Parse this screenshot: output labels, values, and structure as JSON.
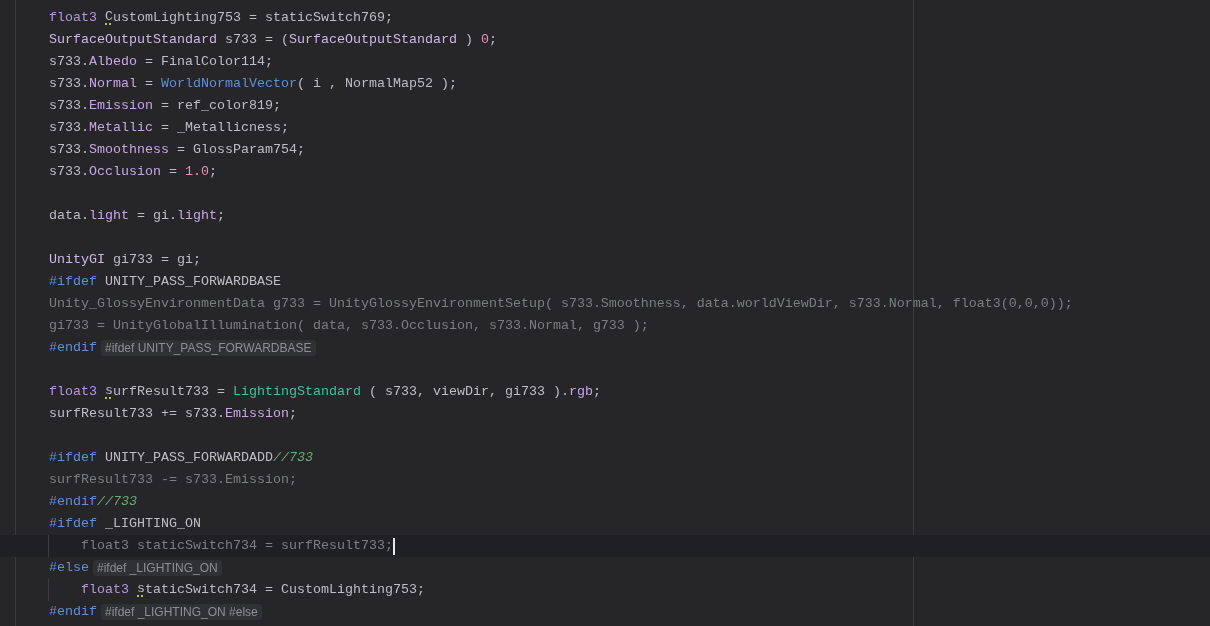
{
  "editor": {
    "lines": [
      {
        "kind": "code",
        "tokens": [
          {
            "kind": "keyword",
            "text": "float3 "
          },
          {
            "kind": "plain",
            "text": "C",
            "squiggle": true
          },
          {
            "kind": "plain",
            "text": "ustomLighting753 = staticSwitch769;"
          }
        ]
      },
      {
        "kind": "code",
        "tokens": [
          {
            "kind": "type",
            "text": "SurfaceOutputStandard"
          },
          {
            "kind": "plain",
            "text": " s733 = ("
          },
          {
            "kind": "type",
            "text": "SurfaceOutputStandard"
          },
          {
            "kind": "plain",
            "text": " ) "
          },
          {
            "kind": "number",
            "text": "0"
          },
          {
            "kind": "plain",
            "text": ";"
          }
        ]
      },
      {
        "kind": "code",
        "tokens": [
          {
            "kind": "plain",
            "text": "s733."
          },
          {
            "kind": "field",
            "text": "Albedo"
          },
          {
            "kind": "plain",
            "text": " = FinalColor114;"
          }
        ]
      },
      {
        "kind": "code",
        "tokens": [
          {
            "kind": "plain",
            "text": "s733."
          },
          {
            "kind": "field",
            "text": "Normal"
          },
          {
            "kind": "plain",
            "text": " = "
          },
          {
            "kind": "function",
            "text": "WorldNormalVector"
          },
          {
            "kind": "plain",
            "text": "( i , NormalMap52 );"
          }
        ]
      },
      {
        "kind": "code",
        "tokens": [
          {
            "kind": "plain",
            "text": "s733."
          },
          {
            "kind": "field",
            "text": "Emission"
          },
          {
            "kind": "plain",
            "text": " = ref_color819;"
          }
        ]
      },
      {
        "kind": "code",
        "tokens": [
          {
            "kind": "plain",
            "text": "s733."
          },
          {
            "kind": "field",
            "text": "Metallic"
          },
          {
            "kind": "plain",
            "text": " = _Metallicness;"
          }
        ]
      },
      {
        "kind": "code",
        "tokens": [
          {
            "kind": "plain",
            "text": "s733."
          },
          {
            "kind": "field",
            "text": "Smoothness"
          },
          {
            "kind": "plain",
            "text": " = GlossParam754;"
          }
        ]
      },
      {
        "kind": "code",
        "tokens": [
          {
            "kind": "plain",
            "text": "s733."
          },
          {
            "kind": "field",
            "text": "Occlusion"
          },
          {
            "kind": "plain",
            "text": " = "
          },
          {
            "kind": "number",
            "text": "1.0"
          },
          {
            "kind": "plain",
            "text": ";"
          }
        ]
      },
      {
        "kind": "blank"
      },
      {
        "kind": "code",
        "tokens": [
          {
            "kind": "plain",
            "text": "data."
          },
          {
            "kind": "field",
            "text": "light"
          },
          {
            "kind": "plain",
            "text": " = gi."
          },
          {
            "kind": "field",
            "text": "light"
          },
          {
            "kind": "plain",
            "text": ";"
          }
        ]
      },
      {
        "kind": "blank"
      },
      {
        "kind": "code",
        "tokens": [
          {
            "kind": "type",
            "text": "UnityGI"
          },
          {
            "kind": "plain",
            "text": " gi733 = gi;"
          }
        ]
      },
      {
        "kind": "code",
        "tokens": [
          {
            "kind": "directive",
            "text": "#ifdef"
          },
          {
            "kind": "plain",
            "text": " UNITY_PASS_FORWARDBASE"
          }
        ]
      },
      {
        "kind": "code",
        "tokens": [
          {
            "kind": "inactive",
            "text": "Unity_GlossyEnvironmentData g733 = UnityGlossyEnvironmentSetup( s733.Smoothness, data.worldViewDir, s733.Normal, float3(0,0,0));"
          }
        ]
      },
      {
        "kind": "code",
        "tokens": [
          {
            "kind": "inactive",
            "text": "gi733 = UnityGlobalIllumination( data, s733.Occlusion, s733.Normal, g733 );"
          }
        ]
      },
      {
        "kind": "code",
        "tokens": [
          {
            "kind": "directive",
            "text": "#endif"
          },
          {
            "kind": "hint",
            "text": "#ifdef UNITY_PASS_FORWARDBASE"
          }
        ]
      },
      {
        "kind": "blank"
      },
      {
        "kind": "code",
        "tokens": [
          {
            "kind": "keyword",
            "text": "float3 "
          },
          {
            "kind": "plain",
            "text": "s",
            "squiggle": true
          },
          {
            "kind": "plain",
            "text": "urfResult733 = "
          },
          {
            "kind": "call",
            "text": "LightingStandard"
          },
          {
            "kind": "plain",
            "text": " ( s733, viewDir, gi733 )."
          },
          {
            "kind": "field",
            "text": "rgb"
          },
          {
            "kind": "plain",
            "text": ";"
          }
        ]
      },
      {
        "kind": "code",
        "tokens": [
          {
            "kind": "plain",
            "text": "surfResult733 += s733."
          },
          {
            "kind": "field",
            "text": "Emission"
          },
          {
            "kind": "plain",
            "text": ";"
          }
        ]
      },
      {
        "kind": "blank"
      },
      {
        "kind": "code",
        "tokens": [
          {
            "kind": "directive",
            "text": "#ifdef"
          },
          {
            "kind": "plain",
            "text": " UNITY_PASS_FORWARDADD"
          },
          {
            "kind": "comment",
            "text": "//733"
          }
        ]
      },
      {
        "kind": "code",
        "tokens": [
          {
            "kind": "inactive",
            "text": "surfResult733 -= s733.Emission;"
          }
        ]
      },
      {
        "kind": "code",
        "tokens": [
          {
            "kind": "directive",
            "text": "#endif"
          },
          {
            "kind": "comment",
            "text": "//733"
          }
        ]
      },
      {
        "kind": "code",
        "tokens": [
          {
            "kind": "directive",
            "text": "#ifdef"
          },
          {
            "kind": "plain",
            "text": " _LIGHTING_ON"
          }
        ]
      },
      {
        "kind": "code",
        "indented": true,
        "current": true,
        "tokens": [
          {
            "kind": "inactive",
            "text": "float3 staticSwitch734 = surfResult733;"
          }
        ]
      },
      {
        "kind": "code",
        "tokens": [
          {
            "kind": "directive",
            "text": "#else"
          },
          {
            "kind": "hint",
            "text": "#ifdef _LIGHTING_ON"
          }
        ]
      },
      {
        "kind": "code",
        "indented": true,
        "tokens": [
          {
            "kind": "keyword",
            "text": "float3 "
          },
          {
            "kind": "plain",
            "text": "s",
            "squiggle": true
          },
          {
            "kind": "plain",
            "text": "taticSwitch734 = CustomLighting753;"
          }
        ]
      },
      {
        "kind": "code",
        "tokens": [
          {
            "kind": "directive",
            "text": "#endif"
          },
          {
            "kind": "hint",
            "text": "#ifdef _LIGHTING_ON #else"
          }
        ]
      }
    ]
  }
}
